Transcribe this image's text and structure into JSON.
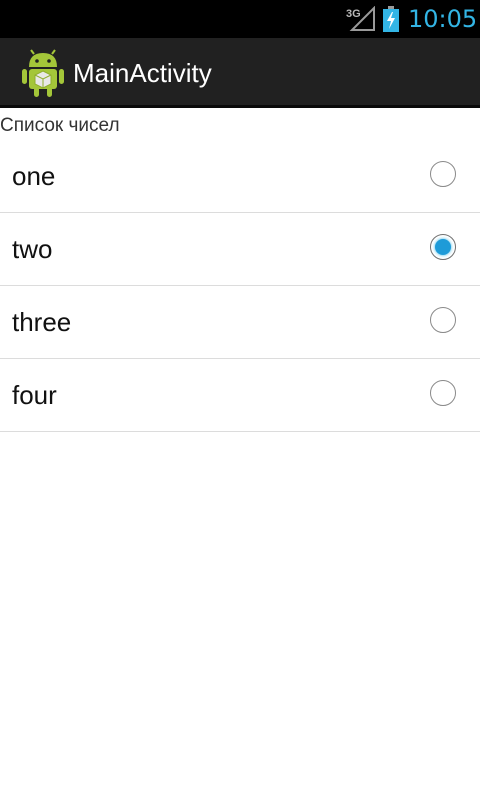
{
  "status_bar": {
    "network_label": "3G",
    "time": "10:05",
    "signal_icon": "signal-strength-icon",
    "battery_icon": "battery-charging-icon",
    "accent_color": "#33b5e5"
  },
  "action_bar": {
    "title": "MainActivity",
    "icon": "android-app-icon",
    "background": "#212121"
  },
  "list": {
    "header": "Список чисел",
    "items": [
      {
        "label": "one",
        "checked": false
      },
      {
        "label": "two",
        "checked": true
      },
      {
        "label": "three",
        "checked": false
      },
      {
        "label": "four",
        "checked": false
      }
    ],
    "selected_color": "#1e9bd8"
  }
}
